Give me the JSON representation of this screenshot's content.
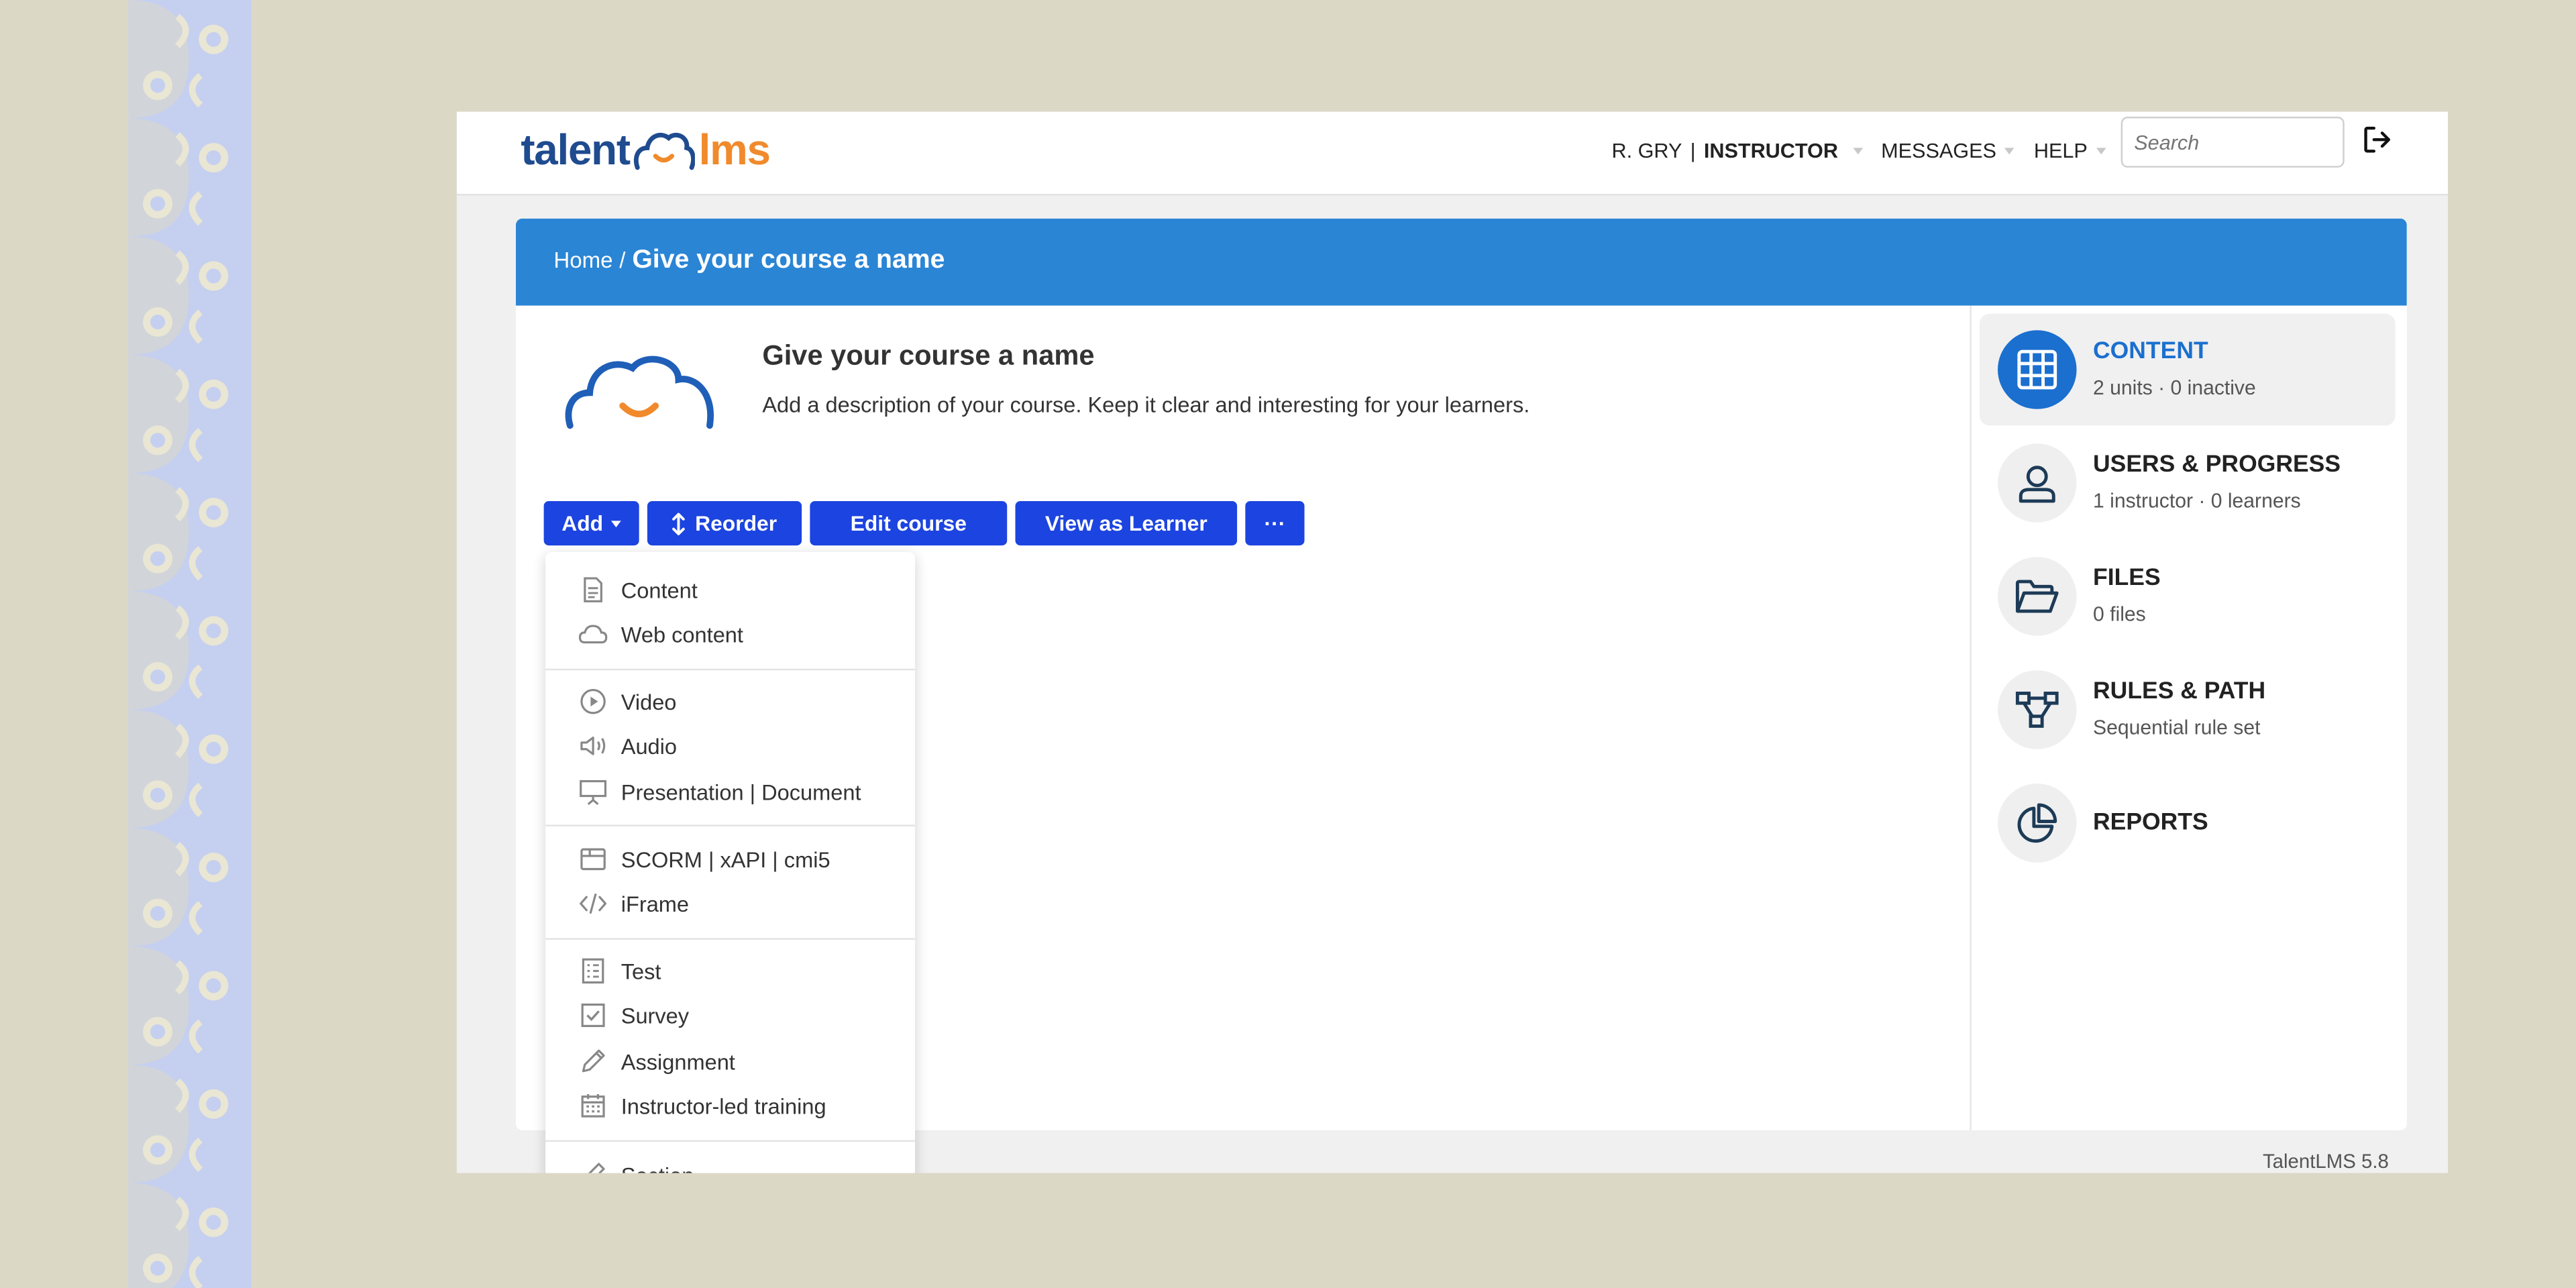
{
  "app": {
    "logo_left": "talent",
    "logo_right": "lms",
    "version": "TalentLMS 5.8"
  },
  "topnav": {
    "user_name": "R. GRY",
    "role": "INSTRUCTOR",
    "messages": "MESSAGES",
    "help": "HELP",
    "search_placeholder": "Search"
  },
  "breadcrumb": {
    "home": "Home",
    "separator": "/",
    "current": "Give your course a name"
  },
  "course": {
    "title": "Give your course a name",
    "description": "Add a description of your course. Keep it clear and interesting for your learners."
  },
  "actions": {
    "add": "Add",
    "reorder": "Reorder",
    "edit": "Edit course",
    "view_as_learner": "View as Learner",
    "more": "···"
  },
  "add_menu": {
    "items": [
      {
        "label": "Content",
        "icon": "document-icon"
      },
      {
        "label": "Web content",
        "icon": "cloud-icon"
      },
      {
        "label": "Video",
        "icon": "play-icon"
      },
      {
        "label": "Audio",
        "icon": "speaker-icon"
      },
      {
        "label": "Presentation | Document",
        "icon": "presentation-icon"
      },
      {
        "label": "SCORM | xAPI | cmi5",
        "icon": "package-icon"
      },
      {
        "label": "iFrame",
        "icon": "code-icon"
      },
      {
        "label": "Test",
        "icon": "test-icon"
      },
      {
        "label": "Survey",
        "icon": "checkbox-icon"
      },
      {
        "label": "Assignment",
        "icon": "pencil-icon"
      },
      {
        "label": "Instructor-led training",
        "icon": "calendar-icon"
      },
      {
        "label": "Section",
        "icon": "section-icon"
      }
    ]
  },
  "sidebar": {
    "items": [
      {
        "label": "CONTENT",
        "sub": "2 units · 0 inactive",
        "icon": "grid-icon",
        "active": true
      },
      {
        "label": "USERS & PROGRESS",
        "sub": "1 instructor · 0 learners",
        "icon": "user-icon"
      },
      {
        "label": "FILES",
        "sub": "0 files",
        "icon": "folder-icon"
      },
      {
        "label": "RULES & PATH",
        "sub": "Sequential rule set",
        "icon": "flow-icon"
      },
      {
        "label": "REPORTS",
        "sub": "",
        "icon": "pie-chart-icon"
      }
    ]
  },
  "colors": {
    "primary_button": "#1c44e0",
    "header_blue": "#2a85d5",
    "active_blue": "#1b6fcf",
    "logo_navy": "#1f4b8f",
    "logo_orange": "#f08a2c",
    "background": "#dbd8c6",
    "pattern": "#c5cff0"
  }
}
